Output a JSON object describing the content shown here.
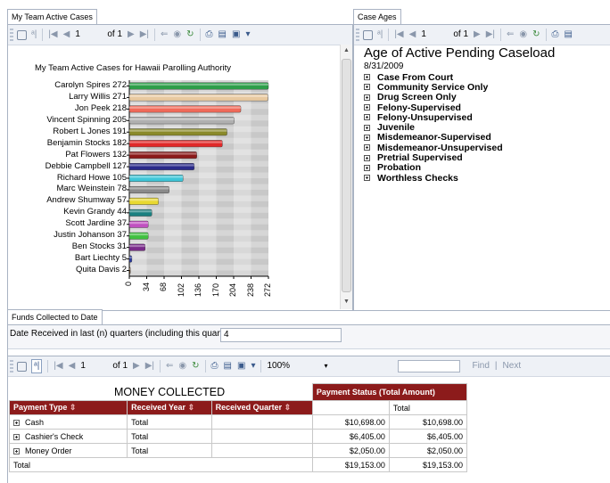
{
  "tabs": {
    "my_team": "My Team Active Cases",
    "case_ages": "Case Ages",
    "funds": "Funds Collected to Date"
  },
  "toolbar": {
    "page_current": "1",
    "page_of": "of 1",
    "zoom": "100%",
    "find": "Find",
    "separator": "|",
    "next": "Next"
  },
  "chart_data": {
    "type": "bar",
    "title": "My Team Active Cases for Hawaii Parolling Authority",
    "categories": [
      "Carolyn Spires",
      "Larry Willis",
      "Jon Peek",
      "Vincent Spinning",
      "Robert L Jones",
      "Benjamin Stocks",
      "Pat Flowers",
      "Debbie Campbell",
      "Richard Howe",
      "Marc Weinstein",
      "Andrew Shumway",
      "Kevin Grandy",
      "Scott Jardine",
      "Justin Johanson",
      "Ben Stocks",
      "Bart Liechty",
      "Quita Davis"
    ],
    "values": [
      272,
      271,
      218,
      205,
      191,
      182,
      132,
      127,
      105,
      78,
      57,
      44,
      37,
      37,
      31,
      5,
      2
    ],
    "colors": [
      "#2e9e4a",
      "#e8c9a0",
      "#f06a5a",
      "#b0b0b0",
      "#8a8a2a",
      "#e02828",
      "#8b1a1a",
      "#2a2a8a",
      "#3ec6d8",
      "#8a8a8a",
      "#e8d830",
      "#1a8080",
      "#c050c0",
      "#40c040",
      "#7a2a8a",
      "#2a3aa0",
      "#5a3a1a"
    ],
    "xticks": [
      0,
      34,
      68,
      102,
      136,
      170,
      204,
      238,
      272
    ],
    "xlim": [
      0,
      272
    ]
  },
  "case_ages": {
    "title": "Age of Active Pending Caseload",
    "date": "8/31/2009",
    "items": [
      "Case From Court",
      "Community Service Only",
      "Drug Screen Only",
      "Felony-Supervised",
      "Felony-Unsupervised",
      "Juvenile",
      "Misdemeanor-Supervised",
      "Misdemeanor-Unsupervised",
      "Pretrial Supervised",
      "Probation",
      "Worthless Checks"
    ]
  },
  "funds": {
    "param_label": "Date Received  in last  (n)  quarters (including this quarter)",
    "param_value": "4",
    "title": "MONEY COLLECTED",
    "payment_status_header": "Payment Status (Total Amount)",
    "col_payment_type": "Payment Type",
    "col_received_year": "Received Year",
    "col_received_quarter": "Received Quarter",
    "col_total": "Total",
    "rows": [
      {
        "type": "Cash",
        "year": "Total",
        "amount": "$10,698.00",
        "total": "$10,698.00"
      },
      {
        "type": "Cashier's Check",
        "year": "Total",
        "amount": "$6,405.00",
        "total": "$6,405.00"
      },
      {
        "type": "Money Order",
        "year": "Total",
        "amount": "$2,050.00",
        "total": "$2,050.00"
      }
    ],
    "grand_total_label": "Total",
    "grand_total_amount": "$19,153.00",
    "grand_total_total": "$19,153.00"
  }
}
